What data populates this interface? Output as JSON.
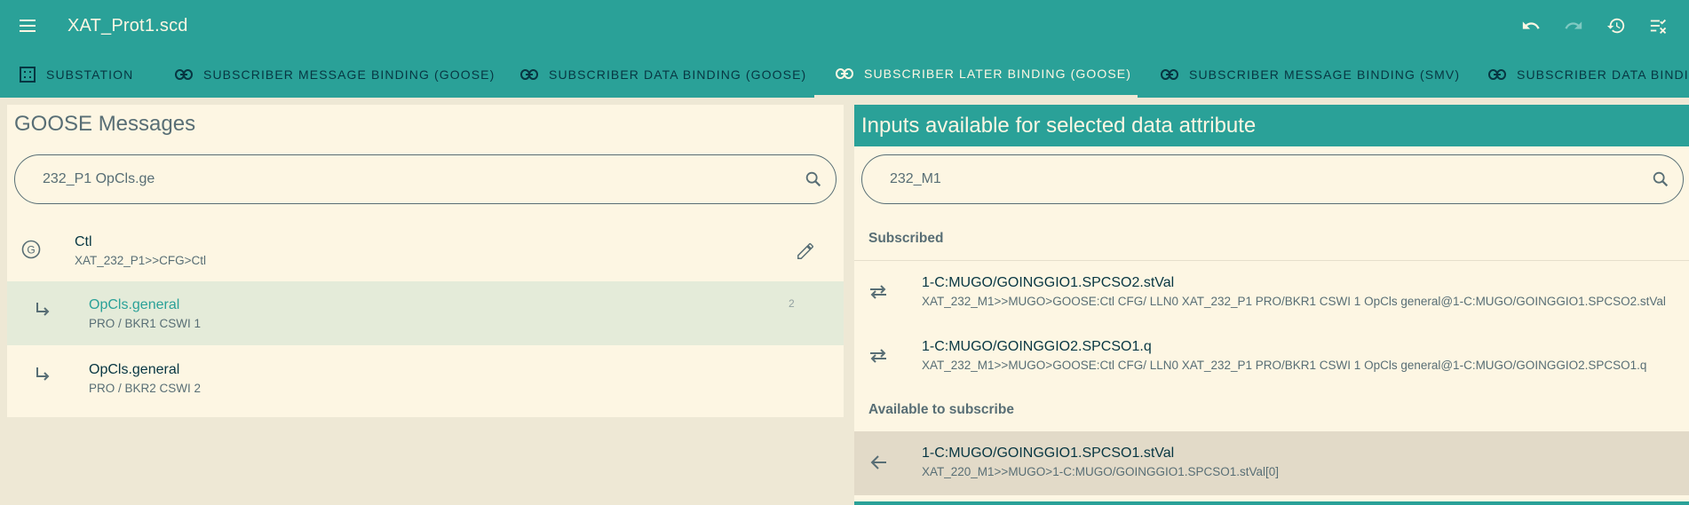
{
  "app": {
    "title": "XAT_Prot1.scd"
  },
  "tabs": [
    {
      "label": "SUBSTATION",
      "icon": "grid-icon"
    },
    {
      "label": "SUBSCRIBER MESSAGE BINDING (GOOSE)",
      "icon": "link-icon"
    },
    {
      "label": "SUBSCRIBER DATA BINDING (GOOSE)",
      "icon": "link-icon"
    },
    {
      "label": "SUBSCRIBER LATER BINDING (GOOSE)",
      "icon": "link-icon",
      "active": true
    },
    {
      "label": "SUBSCRIBER MESSAGE BINDING (SMV)",
      "icon": "link-icon"
    },
    {
      "label": "SUBSCRIBER DATA BINDIN",
      "icon": "link-icon"
    }
  ],
  "left": {
    "title": "GOOSE Messages",
    "search_value": "232_P1 OpCls.ge",
    "control_block": {
      "badge": "G",
      "name": "Ctl",
      "path": "XAT_232_P1>>CFG>Ctl"
    },
    "items": [
      {
        "name": "OpCls.general",
        "path": "PRO / BKR1 CSWI 1",
        "count": "2",
        "selected": true
      },
      {
        "name": "OpCls.general",
        "path": "PRO / BKR2 CSWI 2",
        "count": ""
      }
    ]
  },
  "right": {
    "title": "Inputs available for selected data attribute",
    "search_value": "232_M1",
    "subscribed_label": "Subscribed",
    "subscribed": [
      {
        "name": "1-C:MUGO/GOINGGIO1.SPCSO2.stVal",
        "path": "XAT_232_M1>>MUGO>GOOSE:Ctl CFG/ LLN0 XAT_232_P1 PRO/BKR1 CSWI 1 OpCls general@1-C:MUGO/GOINGGIO1.SPCSO2.stVal"
      },
      {
        "name": "1-C:MUGO/GOINGGIO2.SPCSO1.q",
        "path": "XAT_232_M1>>MUGO>GOOSE:Ctl CFG/ LLN0 XAT_232_P1 PRO/BKR1 CSWI 1 OpCls general@1-C:MUGO/GOINGGIO2.SPCSO1.q"
      }
    ],
    "available_label": "Available to subscribe",
    "available": [
      {
        "name": "1-C:MUGO/GOINGGIO1.SPCSO1.stVal",
        "path": "XAT_220_M1>>MUGO>1-C:MUGO/GOINGGIO1.SPCSO1.stVal[0]"
      }
    ]
  },
  "colors": {
    "primary": "#2aa198",
    "background": "#eee8d5",
    "surface": "#fdf6e3",
    "selected": "#e4ebd9",
    "hover": "#e2dac8"
  }
}
